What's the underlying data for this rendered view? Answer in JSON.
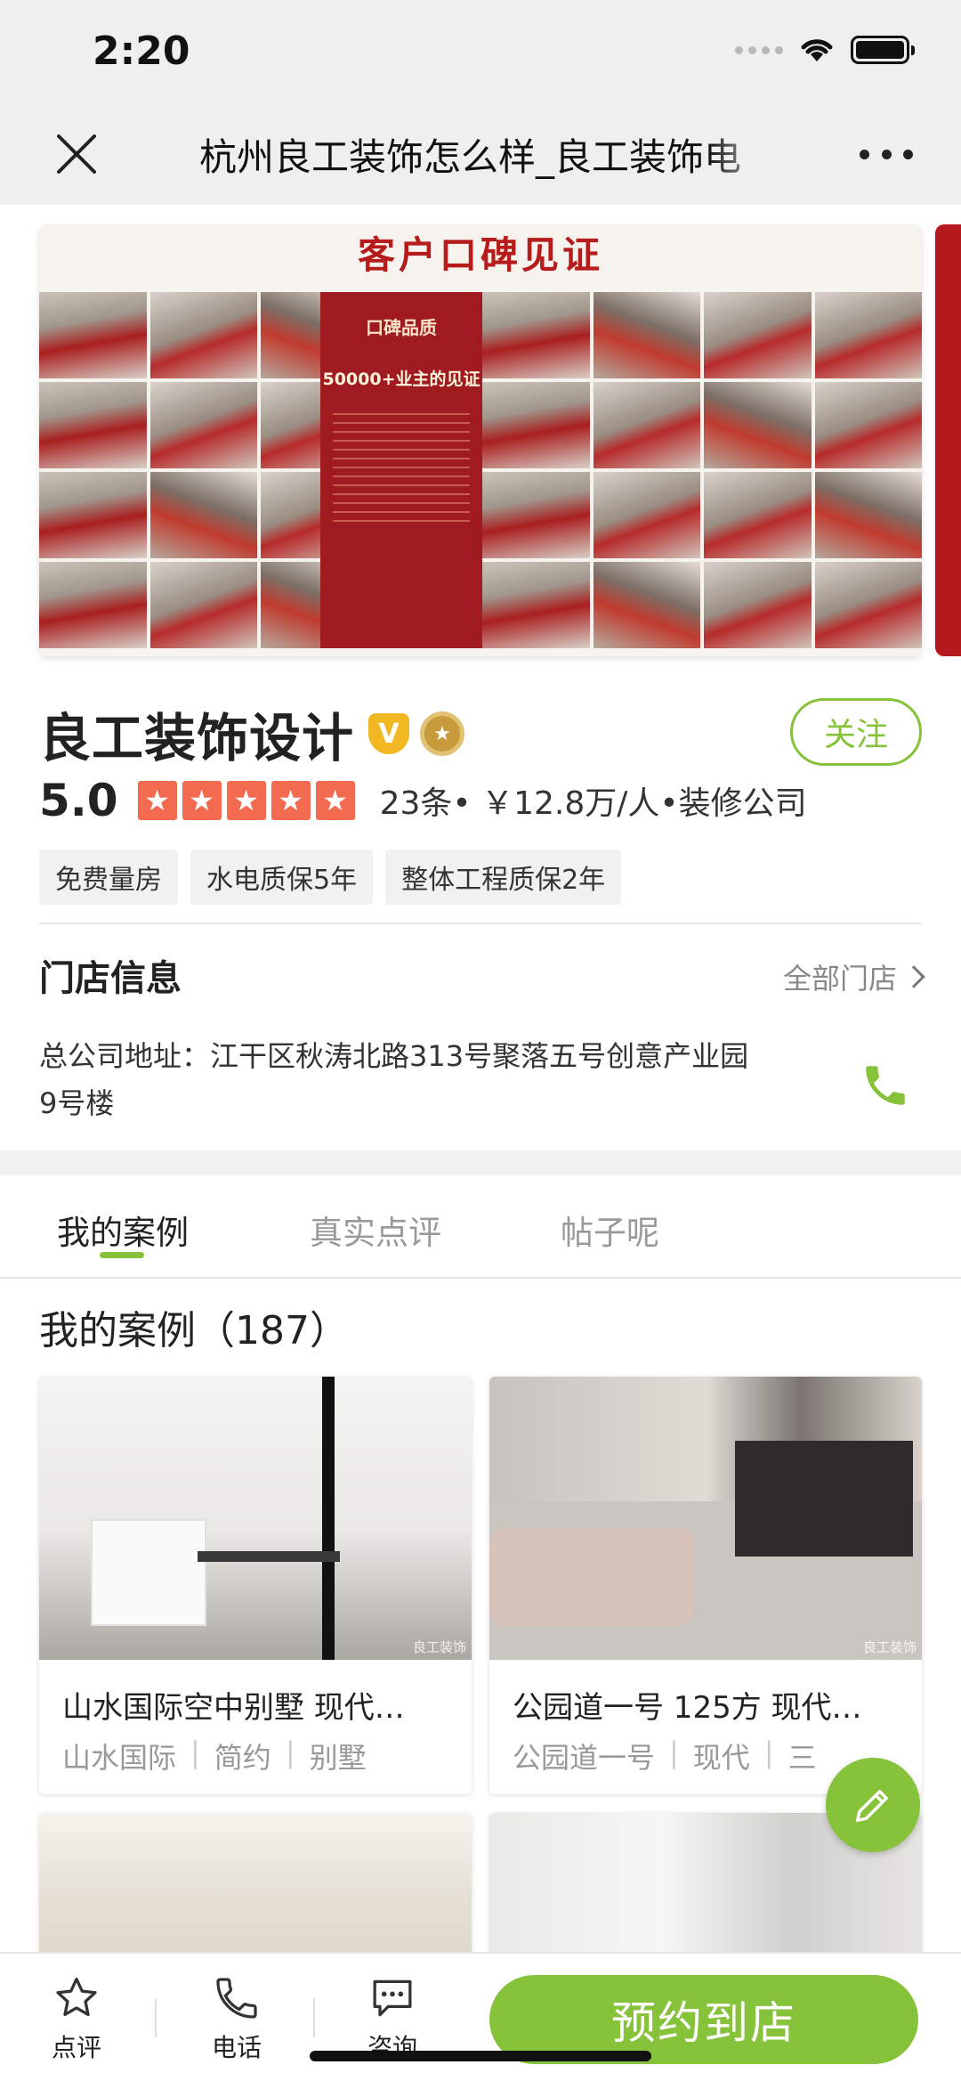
{
  "status_bar": {
    "time": "2:20"
  },
  "nav": {
    "title": "杭州良工装饰怎么样_良工装饰电"
  },
  "banner": {
    "title": "客户口碑见证",
    "center_title": "口碑品质",
    "center_subtitle": "50000+业主的见证"
  },
  "shop": {
    "name": "良工装饰设计",
    "v_badge": "V",
    "follow_label": "关注",
    "rating": "5.0",
    "stars": 5,
    "meta": "23条• ￥12.8万/人•装修公司",
    "tags": [
      "免费量房",
      "水电质保5年",
      "整体工程质保2年"
    ]
  },
  "store": {
    "header": "门店信息",
    "all_stores": "全部门店",
    "address": "总公司地址：江干区秋涛北路313号聚落五号创意产业园9号楼"
  },
  "tabs": [
    "我的案例",
    "真实点评",
    "帖子呢"
  ],
  "cases": {
    "title": "我的案例（187）",
    "items": [
      {
        "title": "山水国际空中别墅 现代…",
        "tags": [
          "山水国际",
          "简约",
          "别墅"
        ],
        "watermark": "良工装饰"
      },
      {
        "title": "公园道一号 125方 现代…",
        "tags": [
          "公园道一号",
          "现代",
          "三"
        ],
        "watermark": "良工装饰"
      }
    ]
  },
  "bottom_bar": {
    "review_label": "点评",
    "phone_label": "电话",
    "consult_label": "咨询",
    "book_label": "预约到店"
  },
  "colors": {
    "accent": "#86c23a",
    "star": "#f26a4f",
    "banner_red": "#b71c1c"
  }
}
